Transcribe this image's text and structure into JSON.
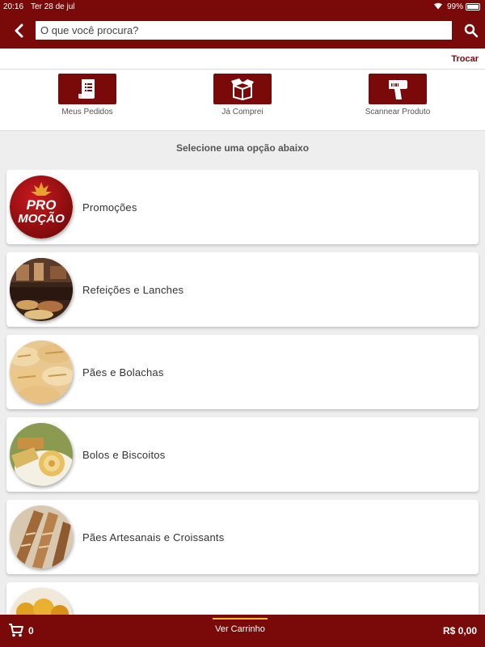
{
  "status_bar": {
    "time": "20:16",
    "date": "Ter 28 de jul",
    "battery": "99%"
  },
  "search": {
    "placeholder": "O que você procura?"
  },
  "store": {
    "change_label": "Trocar"
  },
  "actions": [
    {
      "label": "Meus Pedidos",
      "icon": "receipt-icon"
    },
    {
      "label": "Já Comprei",
      "icon": "box-icon"
    },
    {
      "label": "Scannear Produto",
      "icon": "barcode-scanner-icon"
    }
  ],
  "section_title": "Selecione uma opção abaixo",
  "categories": [
    {
      "name": "Promoções",
      "badge_line1": "PRO",
      "badge_line2": "MOÇÃO"
    },
    {
      "name": "Refeições e Lanches"
    },
    {
      "name": "Pães e Bolachas"
    },
    {
      "name": "Bolos e Biscoitos"
    },
    {
      "name": "Pães Artesanais e Croissants"
    },
    {
      "name": ""
    }
  ],
  "cart": {
    "count": "0",
    "view_label": "Ver Carrinho",
    "total": "R$ 0,00"
  },
  "colors": {
    "brand": "#7a0a0a",
    "accent": "#f0c030"
  }
}
